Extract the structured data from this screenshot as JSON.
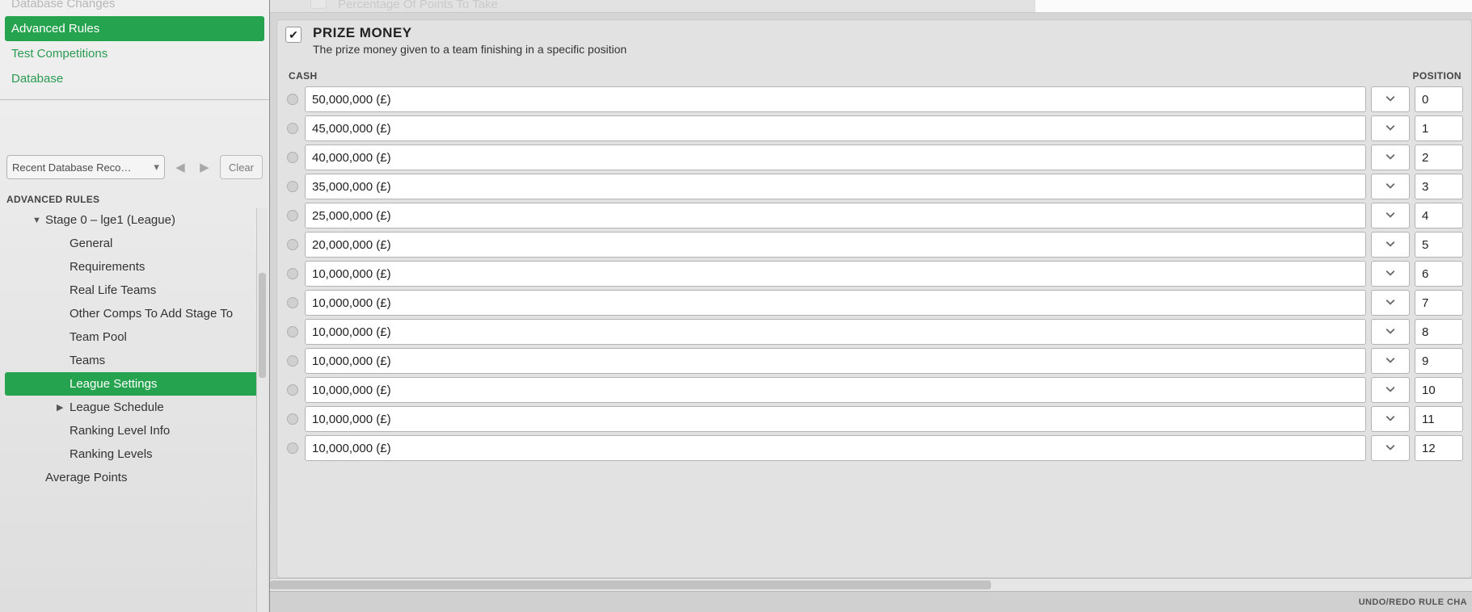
{
  "sidebar": {
    "top_items": [
      {
        "label": "Database Changes",
        "status": "cut"
      },
      {
        "label": "Advanced Rules",
        "status": "active"
      },
      {
        "label": "Test Competitions",
        "status": "normal"
      },
      {
        "label": "Database",
        "status": "normal"
      }
    ],
    "recent_combo": "Recent Database Reco…",
    "clear_label": "Clear",
    "section_label": "ADVANCED RULES",
    "tree": [
      {
        "label": "Stage 0 – lge1 (League)",
        "level": 1,
        "arrow": "down",
        "active": false
      },
      {
        "label": "General",
        "level": 2,
        "arrow": "none",
        "active": false
      },
      {
        "label": "Requirements",
        "level": 2,
        "arrow": "none",
        "active": false
      },
      {
        "label": "Real Life Teams",
        "level": 2,
        "arrow": "none",
        "active": false
      },
      {
        "label": "Other Comps To Add Stage To",
        "level": 2,
        "arrow": "none",
        "active": false
      },
      {
        "label": "Team Pool",
        "level": 2,
        "arrow": "none",
        "active": false
      },
      {
        "label": "Teams",
        "level": 2,
        "arrow": "none",
        "active": false
      },
      {
        "label": "League Settings",
        "level": 2,
        "arrow": "none",
        "active": true
      },
      {
        "label": "League Schedule",
        "level": 2,
        "arrow": "right",
        "active": false
      },
      {
        "label": "Ranking Level Info",
        "level": 2,
        "arrow": "none",
        "active": false
      },
      {
        "label": "Ranking Levels",
        "level": 2,
        "arrow": "none",
        "active": false
      },
      {
        "label": "Average Points",
        "level": 1,
        "arrow": "none",
        "active": false
      }
    ]
  },
  "panel": {
    "faded_option_label": "Percentage Of Points To Take",
    "title": "PRIZE MONEY",
    "description": "The prize money given to a team finishing in a specific position",
    "col_cash": "CASH",
    "col_pos": "POSITION",
    "rows": [
      {
        "cash": "50,000,000 (£)",
        "pos": "0"
      },
      {
        "cash": "45,000,000 (£)",
        "pos": "1"
      },
      {
        "cash": "40,000,000 (£)",
        "pos": "2"
      },
      {
        "cash": "35,000,000 (£)",
        "pos": "3"
      },
      {
        "cash": "25,000,000 (£)",
        "pos": "4"
      },
      {
        "cash": "20,000,000 (£)",
        "pos": "5"
      },
      {
        "cash": "10,000,000 (£)",
        "pos": "6"
      },
      {
        "cash": "10,000,000 (£)",
        "pos": "7"
      },
      {
        "cash": "10,000,000 (£)",
        "pos": "8"
      },
      {
        "cash": "10,000,000 (£)",
        "pos": "9"
      },
      {
        "cash": "10,000,000 (£)",
        "pos": "10"
      },
      {
        "cash": "10,000,000 (£)",
        "pos": "11"
      },
      {
        "cash": "10,000,000 (£)",
        "pos": "12"
      }
    ]
  },
  "footer": {
    "undo_label": "UNDO/REDO RULE CHA"
  }
}
